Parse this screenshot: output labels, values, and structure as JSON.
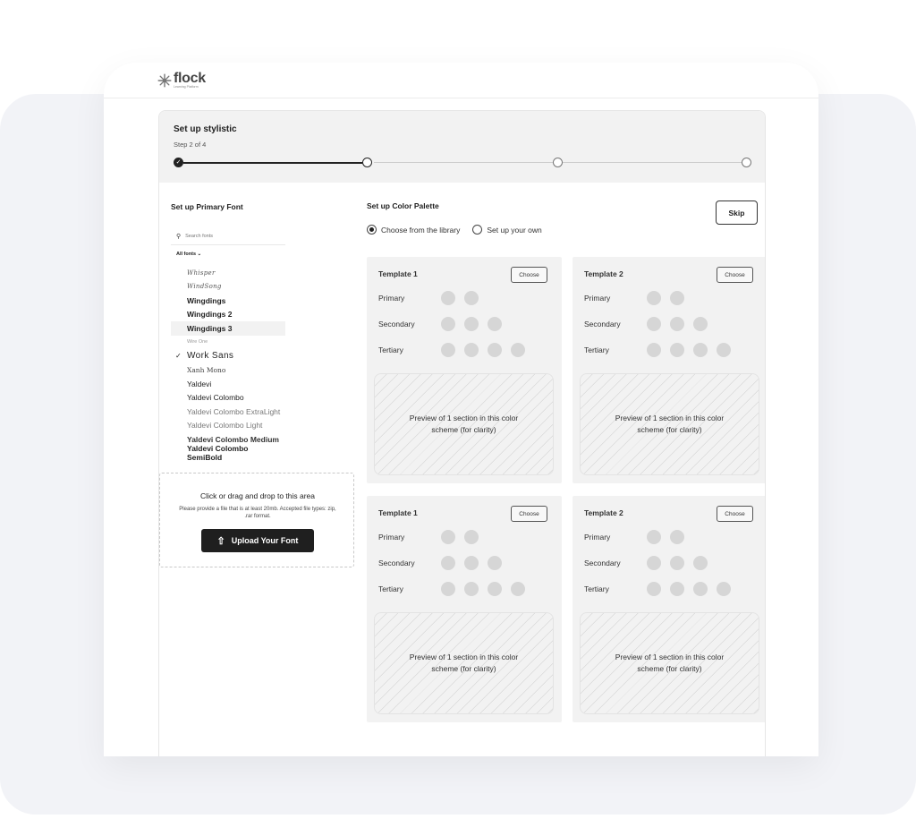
{
  "brand": {
    "name": "flock",
    "tagline": "Learning Platform"
  },
  "stepper": {
    "title": "Set up stylistic",
    "subtitle": "Step 2 of 4",
    "check_glyph": "✓"
  },
  "font_section": {
    "label": "Set up Primary Font",
    "search_placeholder": "Search fonts",
    "filter_label": "All fonts ⌄",
    "fonts": [
      {
        "name": "Whisper",
        "style": "script"
      },
      {
        "name": "WindSong",
        "style": "script"
      },
      {
        "name": "Wingdings",
        "style": "bold"
      },
      {
        "name": "Wingdings 2",
        "style": "bold"
      },
      {
        "name": "Wingdings 3",
        "style": "bold"
      },
      {
        "name": "Wire One",
        "style": "thin"
      },
      {
        "name": "Work Sans",
        "style": "selected"
      },
      {
        "name": "Xanh Mono",
        "style": "serif"
      },
      {
        "name": "Yaldevi",
        "style": "regular"
      },
      {
        "name": "Yaldevi Colombo",
        "style": "regular"
      },
      {
        "name": "Yaldevi Colombo ExtraLight",
        "style": "light"
      },
      {
        "name": "Yaldevi Colombo Light",
        "style": "light"
      },
      {
        "name": "Yaldevi Colombo Medium",
        "style": "medium"
      },
      {
        "name": "Yaldevi Colombo SemiBold",
        "style": "bold"
      }
    ],
    "selected_check": "✓"
  },
  "upload": {
    "title": "Click or drag and drop to this area",
    "description": "Please provide a file that is at least 20mb. Accepted file types: zip, .rar format.",
    "button_label": "Upload Your Font"
  },
  "palette_section": {
    "label": "Set up Color Palette",
    "options": [
      "Choose from the library",
      "Set up your own"
    ],
    "skip_label": "Skip"
  },
  "templates": [
    {
      "title": "Template 1",
      "choose": "Choose",
      "rows": [
        {
          "label": "Primary",
          "count": 2
        },
        {
          "label": "Secondary",
          "count": 3
        },
        {
          "label": "Tertiary",
          "count": 4
        }
      ],
      "preview": "Preview of 1 section in this color scheme (for clarity)"
    },
    {
      "title": "Template 2",
      "choose": "Choose",
      "rows": [
        {
          "label": "Primary",
          "count": 2
        },
        {
          "label": "Secondary",
          "count": 3
        },
        {
          "label": "Tertiary",
          "count": 4
        }
      ],
      "preview": "Preview of 1 section in this color scheme (for clarity)"
    },
    {
      "title": "Template 1",
      "choose": "Choose",
      "rows": [
        {
          "label": "Primary",
          "count": 2
        },
        {
          "label": "Secondary",
          "count": 3
        },
        {
          "label": "Tertiary",
          "count": 4
        }
      ],
      "preview": "Preview of 1 section in this color scheme (for clarity)"
    },
    {
      "title": "Template 2",
      "choose": "Choose",
      "rows": [
        {
          "label": "Primary",
          "count": 2
        },
        {
          "label": "Secondary",
          "count": 3
        },
        {
          "label": "Tertiary",
          "count": 4
        }
      ],
      "preview": "Preview of 1 section in this color scheme (for clarity)"
    }
  ],
  "colors": {
    "accent": "#1f1f1f",
    "swatch": "#d6d6d6",
    "panel": "#f2f2f2"
  }
}
